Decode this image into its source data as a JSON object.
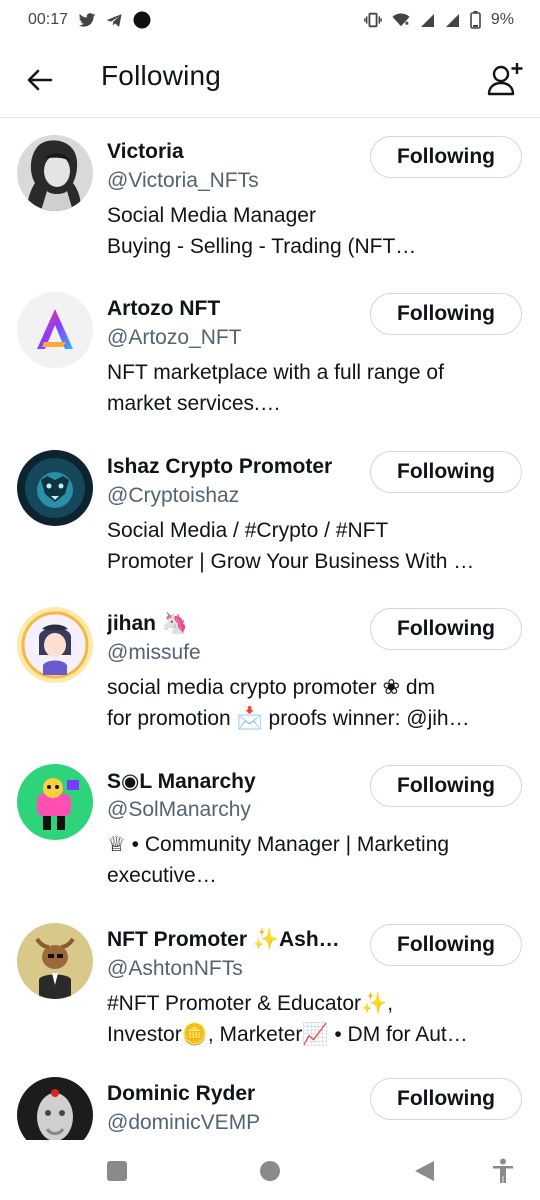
{
  "status_bar": {
    "time": "00:17",
    "battery": "9%",
    "left_icons": [
      "twitter-icon",
      "telegram-icon",
      "dot-icon"
    ],
    "right_icons": [
      "vibrate-icon",
      "wifi-icon",
      "signal-icon",
      "signal-icon",
      "battery-icon"
    ]
  },
  "header": {
    "title": "Following",
    "back_icon": "arrow-left-icon",
    "add_icon": "add-user-icon"
  },
  "users": [
    {
      "name": "Victoria",
      "handle": "@Victoria_NFTs",
      "bio": [
        "Social Media Manager",
        "Buying - Selling - Trading (NFT…"
      ],
      "button": "Following",
      "avatar": "photo-woman"
    },
    {
      "name": "Artozo NFT",
      "handle": "@Artozo_NFT",
      "bio": [
        "NFT marketplace with a full range of",
        "market services.…"
      ],
      "button": "Following",
      "avatar": "artozo-logo"
    },
    {
      "name": "Ishaz Crypto Promoter",
      "handle": "@Cryptoishaz",
      "bio": [
        "Social Media / #Crypto / #NFT",
        "Promoter | Grow Your Business With …"
      ],
      "button": "Following",
      "avatar": "lion"
    },
    {
      "name": "jihan 🦄",
      "handle": "@missufe",
      "bio": [
        "social media crypto promoter ❀ dm",
        "for promotion 📩 proofs winner: @jih…"
      ],
      "button": "Following",
      "avatar": "cartoon-girl"
    },
    {
      "name": "S◉L Manarchy",
      "handle": "@SolManarchy",
      "bio": [
        "♕ • Community Manager | Marketing",
        "executive…"
      ],
      "button": "Following",
      "avatar": "monkey-art"
    },
    {
      "name": "NFT Promoter ✨Ash…",
      "handle": "@AshtonNFTs",
      "bio": [
        "#NFT Promoter & Educator✨,",
        "Investor🪙, Marketer📈 • DM for Aut…"
      ],
      "button": "Following",
      "avatar": "bull-suit"
    },
    {
      "name": "Dominic Ryder",
      "handle": "@dominicVEMP",
      "bio": [],
      "button": "Following",
      "avatar": "statue-face"
    }
  ],
  "nav_bar": [
    "recents-icon",
    "home-icon",
    "back-icon",
    "accessibility-icon"
  ],
  "colors": {
    "text": "#0f1419",
    "secondary_text": "#536471",
    "button_border": "#cfd9de",
    "divider": "#e6e6e6",
    "nav_icon": "#8a8a8a"
  }
}
